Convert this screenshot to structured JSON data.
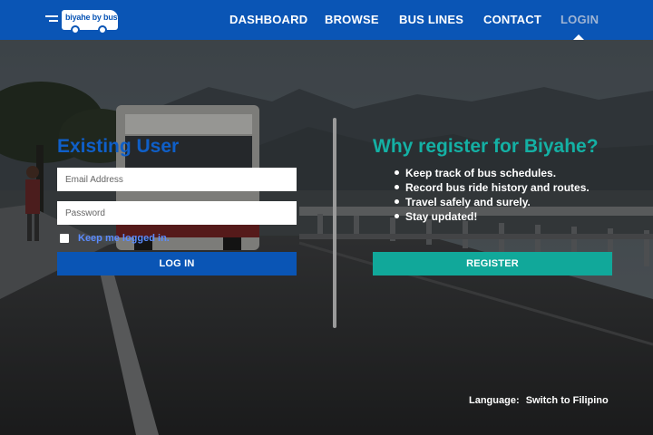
{
  "header": {
    "logo_text": "biyahe by bus",
    "nav": [
      {
        "label": "DASHBOARD"
      },
      {
        "label": "BROWSE"
      },
      {
        "label": "BUS LINES"
      },
      {
        "label": "CONTACT"
      },
      {
        "label": "LOGIN",
        "active": true
      }
    ]
  },
  "login": {
    "heading": "Existing User",
    "email_placeholder": "Email Address",
    "password_placeholder": "Password",
    "remember_label": "Keep me logged in.",
    "remember_checked": false,
    "button_label": "LOG IN"
  },
  "register": {
    "heading": "Why register for Biyahe?",
    "benefits": [
      "Keep track of bus schedules.",
      "Record bus ride history and routes.",
      "Travel safely and surely.",
      "Stay updated!"
    ],
    "button_label": "REGISTER"
  },
  "footer": {
    "language_label": "Language:",
    "language_link": "Switch to Filipino"
  },
  "colors": {
    "header_bg": "#0a55b5",
    "login_heading": "#0f5fc8",
    "register_heading": "#14b0a4",
    "login_button": "#0a55b5",
    "register_button": "#11a89a",
    "remember_text": "#5b8cff",
    "nav_active": "#9fb4d3"
  }
}
